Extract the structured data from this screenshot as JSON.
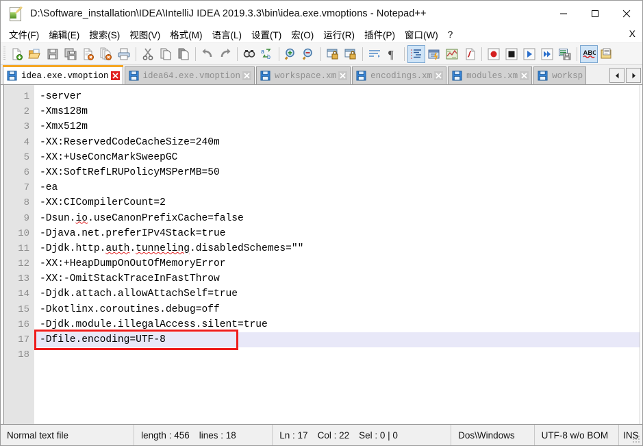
{
  "window": {
    "title": "D:\\Software_installation\\IDEA\\IntelliJ IDEA 2019.3.3\\bin\\idea.exe.vmoptions - Notepad++",
    "icon": "notepad-plus-plus-icon",
    "minimize_label": "minimize-icon",
    "maximize_label": "maximize-icon",
    "close_label": "close-icon"
  },
  "menubar": {
    "items": [
      {
        "label": "文件(F)",
        "name": "menu-file"
      },
      {
        "label": "编辑(E)",
        "name": "menu-edit"
      },
      {
        "label": "搜索(S)",
        "name": "menu-search"
      },
      {
        "label": "视图(V)",
        "name": "menu-view"
      },
      {
        "label": "格式(M)",
        "name": "menu-format"
      },
      {
        "label": "语言(L)",
        "name": "menu-language"
      },
      {
        "label": "设置(T)",
        "name": "menu-settings"
      },
      {
        "label": "宏(O)",
        "name": "menu-macro"
      },
      {
        "label": "运行(R)",
        "name": "menu-run"
      },
      {
        "label": "插件(P)",
        "name": "menu-plugins"
      },
      {
        "label": "窗口(W)",
        "name": "menu-window"
      },
      {
        "label": "?",
        "name": "menu-help"
      }
    ],
    "close_document": "X"
  },
  "toolbar": {
    "groups": [
      [
        "new-file-icon",
        "open-file-icon",
        "save-icon",
        "save-all-icon",
        "close-file-icon",
        "close-all-files-icon",
        "print-icon"
      ],
      [
        "cut-icon",
        "copy-icon",
        "paste-icon"
      ],
      [
        "undo-icon",
        "redo-icon"
      ],
      [
        "find-icon",
        "replace-icon"
      ],
      [
        "zoom-in-icon",
        "zoom-out-icon"
      ],
      [
        "sync-vertical-scroll-icon",
        "sync-horizontal-scroll-icon"
      ],
      [
        "word-wrap-icon",
        "show-all-characters-icon"
      ],
      [
        "indent-guide-icon",
        "user-defined-language-icon",
        "document-map-icon",
        "function-list-icon"
      ],
      [
        "record-macro-icon",
        "stop-recording-icon",
        "play-macro-icon",
        "play-macro-multiple-icon",
        "save-macro-icon"
      ],
      [
        "spell-check-icon",
        "document-list-icon"
      ]
    ],
    "active_buttons": [
      "indent-guide-icon",
      "spell-check-icon"
    ]
  },
  "tabs": {
    "items": [
      {
        "label": "idea.exe.vmoption",
        "active": true
      },
      {
        "label": "idea64.exe.vmoption",
        "active": false
      },
      {
        "label": "workspace.xm",
        "active": false
      },
      {
        "label": "encodings.xm",
        "active": false
      },
      {
        "label": "modules.xm",
        "active": false
      },
      {
        "label": "worksp",
        "active": false
      }
    ],
    "scroll_left": "◀",
    "scroll_right": "▶"
  },
  "editor": {
    "line_numbers": [
      1,
      2,
      3,
      4,
      5,
      6,
      7,
      8,
      9,
      10,
      11,
      12,
      13,
      14,
      15,
      16,
      17,
      18
    ],
    "current_line": 17,
    "lines": [
      {
        "n": 1,
        "text": "-server"
      },
      {
        "n": 2,
        "text": "-Xms128m"
      },
      {
        "n": 3,
        "text": "-Xmx512m"
      },
      {
        "n": 4,
        "text": "-XX:ReservedCodeCacheSize=240m"
      },
      {
        "n": 5,
        "text": "-XX:+UseConcMarkSweepGC"
      },
      {
        "n": 6,
        "text": "-XX:SoftRefLRUPolicyMSPerMB=50"
      },
      {
        "n": 7,
        "text": "-ea"
      },
      {
        "n": 8,
        "text": "-XX:CICompilerCount=2"
      },
      {
        "n": 9,
        "text": "-Dsun.io.useCanonPrefixCache=false",
        "misspelled": [
          "Dsun",
          "io"
        ]
      },
      {
        "n": 10,
        "text": "-Djava.net.preferIPv4Stack=true",
        "misspelled": [
          "Djava"
        ]
      },
      {
        "n": 11,
        "text": "-Djdk.http.auth.tunneling.disabledSchemes=\"\"",
        "misspelled": [
          "Djdk",
          "auth",
          "tunneling"
        ]
      },
      {
        "n": 12,
        "text": "-XX:+HeapDumpOnOutOfMemoryError"
      },
      {
        "n": 13,
        "text": "-XX:-OmitStackTraceInFastThrow"
      },
      {
        "n": 14,
        "text": "-Djdk.attach.allowAttachSelf=true",
        "misspelled": [
          "Djdk"
        ]
      },
      {
        "n": 15,
        "text": "-Dkotlinx.coroutines.debug=off",
        "misspelled": [
          "Dkotlinx"
        ]
      },
      {
        "n": 16,
        "text": "-Djdk.module.illegalAccess.silent=true",
        "misspelled": [
          "Djdk"
        ]
      },
      {
        "n": 17,
        "text": "-Dfile.encoding=UTF-8",
        "misspelled": [
          "Dfile"
        ]
      },
      {
        "n": 18,
        "text": ""
      }
    ],
    "annotation": {
      "name": "red-highlight-box",
      "target_line": 17,
      "color": "#ee1c1c"
    },
    "colors": {
      "background": "#ffffff",
      "gutter": "#e4e4e4",
      "line_number": "#8c8c8c",
      "current_line_highlight": "#e8e8f8",
      "spell_error": "#e02020",
      "text": "#000000"
    }
  },
  "statusbar": {
    "file_type": "Normal text file",
    "length_label": "length : 456",
    "lines_label": "lines : 18",
    "ln": "Ln : 17",
    "col": "Col : 22",
    "sel": "Sel : 0 | 0",
    "eol": "Dos\\Windows",
    "encoding": "UTF-8 w/o BOM",
    "insert_mode": "INS"
  },
  "theme": {
    "accent_orange": "#f5a623",
    "window_bg": "#f0f0f0",
    "toolbar_bg": "#f5f5f5",
    "tab_inactive": "#d2d2d2",
    "border": "#9a9a9a"
  }
}
